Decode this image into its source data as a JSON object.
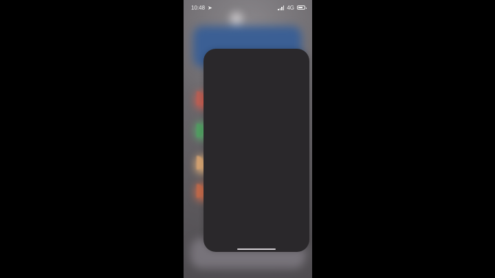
{
  "status_bar": {
    "time": "10:48",
    "network": "4G",
    "battery_level_percent": 70
  },
  "switcher": {
    "active_card_label": "",
    "home_indicator": "home-indicator"
  },
  "icons": {
    "location": "location-arrow-icon",
    "signal": "signal-icon",
    "battery": "battery-icon"
  },
  "colors": {
    "background": "#000000",
    "wallpaper": "#5d5a5f",
    "card": "#2a282b",
    "widget_blue": "#3b5f94"
  }
}
